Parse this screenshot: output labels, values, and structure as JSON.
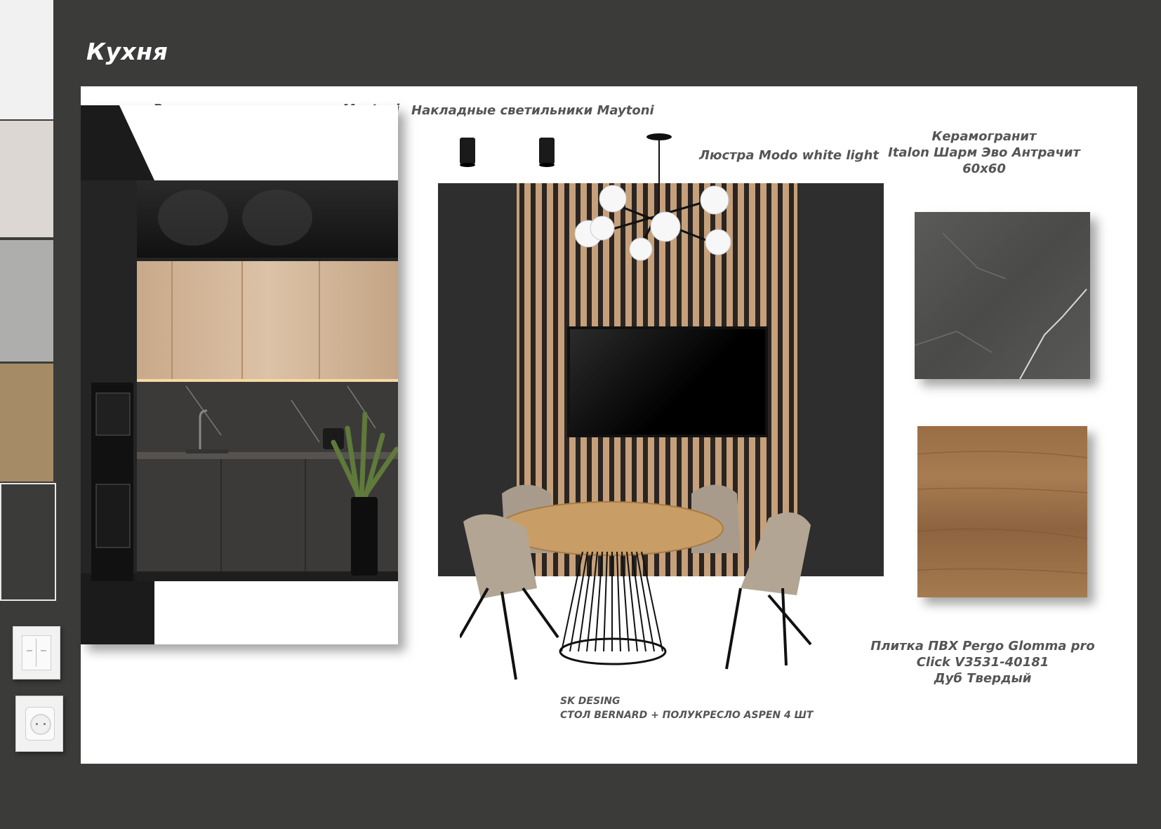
{
  "page": {
    "title": "Кухня"
  },
  "palette": {
    "swatches": [
      {
        "name": "white",
        "color": "#f1f1f1"
      },
      {
        "name": "light-greige",
        "color": "#dcd7d2"
      },
      {
        "name": "warm-grey",
        "color": "#aeaeac"
      },
      {
        "name": "sand-brown",
        "color": "#a58c67"
      },
      {
        "name": "graphite",
        "color": "#3b3b39"
      }
    ]
  },
  "accessories": [
    {
      "name": "light-switch",
      "icon": "double-switch-icon"
    },
    {
      "name": "power-socket",
      "icon": "socket-icon"
    }
  ],
  "products": {
    "recessed_lights": "Встроенные светильники  Maytoni",
    "surface_lights": "Накладные светильники  Maytoni",
    "chandelier": "Люстра Modo white light",
    "porcelain_tile": {
      "line1": "Керамогранит",
      "line2": "Italon Шарм Эво Антрачит",
      "line3": "60х60"
    },
    "vinyl_tile": {
      "line1": "Плитка ПВХ Pergo Glomma pro",
      "line2": "Click V3531-40181",
      "line3": "Дуб Твердый"
    },
    "dining_set": {
      "line1": "SK  DESING",
      "line2": "СТОЛ BERNARD + ПОЛУКРЕСЛО ASPEN 4 ШТ"
    }
  },
  "colors": {
    "background": "#3b3b39",
    "board": "#ffffff",
    "label_text": "#555555",
    "wood": "#b9946a",
    "graphite_panel": "#2e2e2e"
  }
}
